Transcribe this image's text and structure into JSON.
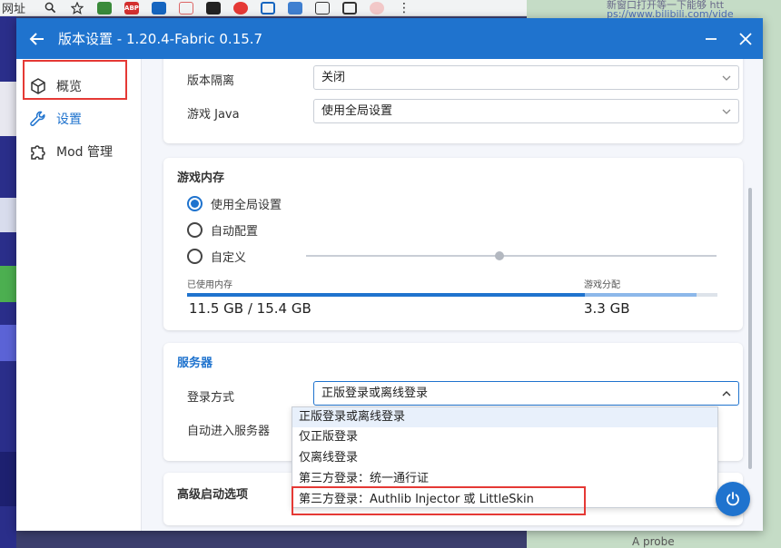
{
  "browser": {
    "address_label": "网址",
    "ext_icons": [
      "zoom-icon",
      "star-icon",
      "ext-green-icon",
      "abp-icon",
      "ext-blue-icon",
      "ext-cat-icon",
      "ext-dark-icon",
      "ext-red-icon",
      "ext-shield-icon",
      "ext-person-icon",
      "puzzle-icon",
      "sidebar-icon",
      "avatar-icon",
      "menu-icon"
    ]
  },
  "background_page": {
    "snippet_line1": "新窗口打开等一下能够 htt",
    "snippet_line2": "ps://www.bilibili.com/vide",
    "bottom_text": "A probe"
  },
  "window": {
    "title": "版本设置 - 1.20.4-Fabric 0.15.7",
    "accent": "#1f73ce"
  },
  "sidebar": {
    "items": [
      {
        "label": "概览",
        "icon": "cube-icon"
      },
      {
        "label": "设置",
        "icon": "wrench-icon",
        "active": true
      },
      {
        "label": "Mod 管理",
        "icon": "puzzle-icon"
      }
    ]
  },
  "general": {
    "isolation_label": "版本隔离",
    "isolation_value": "关闭",
    "java_label": "游戏 Java",
    "java_value": "使用全局设置"
  },
  "memory": {
    "title": "游戏内存",
    "options": [
      {
        "label": "使用全局设置",
        "selected": true
      },
      {
        "label": "自动配置",
        "selected": false
      },
      {
        "label": "自定义",
        "selected": false
      }
    ],
    "used_label": "已使用内存",
    "used_value": "11.5 GB / 15.4 GB",
    "alloc_label": "游戏分配",
    "alloc_value": "3.3 GB",
    "used_fraction": 0.75,
    "alloc_fraction": 0.21
  },
  "server": {
    "title": "服务器",
    "login_label": "登录方式",
    "login_value": "正版登录或离线登录",
    "auto_join_label": "自动进入服务器",
    "options": [
      "正版登录或离线登录",
      "仅正版登录",
      "仅离线登录",
      "第三方登录：统一通行证",
      "第三方登录：Authlib Injector 或 LittleSkin"
    ]
  },
  "advanced": {
    "title": "高级启动选项"
  }
}
